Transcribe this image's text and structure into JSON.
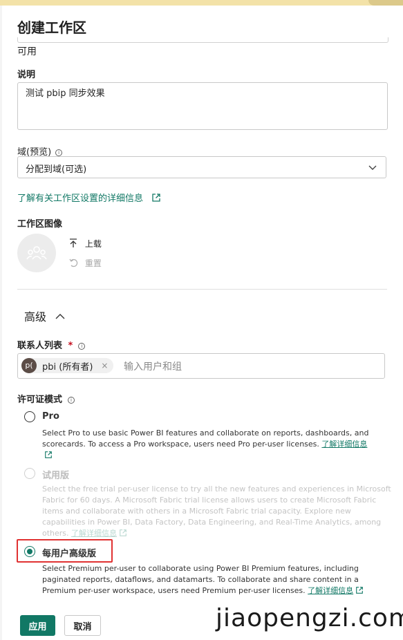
{
  "dialog": {
    "title": "创建工作区"
  },
  "availability": {
    "text": "可用"
  },
  "description": {
    "label": "说明",
    "value": "测试 pbip 同步效果"
  },
  "domain": {
    "label": "域(预览)",
    "value": "分配到域(可选)"
  },
  "settings_link": {
    "text": "了解有关工作区设置的详细信息"
  },
  "workspace_image": {
    "label": "工作区图像",
    "upload_label": "上载",
    "reset_label": "重置"
  },
  "advanced": {
    "label": "高级"
  },
  "contacts": {
    "label": "联系人列表",
    "required_mark": "*",
    "chip": {
      "initials": "p(",
      "name": "pbi (所有者)",
      "remove": "×"
    },
    "placeholder": "输入用户和组"
  },
  "license": {
    "label": "许可证模式",
    "options": [
      {
        "title": "Pro",
        "description": "Select Pro to use basic Power BI features and collaborate on reports, dashboards, and scorecards. To access a Pro workspace, users need Pro per-user licenses.",
        "link": "了解详细信息",
        "selected": false,
        "disabled": false
      },
      {
        "title": "试用版",
        "description": "Select the free trial per-user license to try all the new features and experiences in Microsoft Fabric for 60 days. A Microsoft Fabric trial license allows users to create Microsoft Fabric items and collaborate with others in a Microsoft Fabric trial capacity. Explore new capabilities in Power BI, Data Factory, Data Engineering, and Real-Time Analytics, among others.",
        "link": "了解详细信息",
        "selected": false,
        "disabled": true
      },
      {
        "title": "每用户高级版",
        "description": "Select Premium per-user to collaborate using Power BI Premium features, including paginated reports, dataflows, and datamarts. To collaborate and share content in a Premium per-user workspace, users need Premium per-user licenses.",
        "link": "了解详细信息",
        "selected": true,
        "disabled": false
      }
    ]
  },
  "buttons": {
    "apply": "应用",
    "cancel": "取消"
  },
  "watermark": {
    "text": "jiaopengzi.com"
  },
  "colors": {
    "accent": "#117865",
    "highlight": "#e03131"
  }
}
